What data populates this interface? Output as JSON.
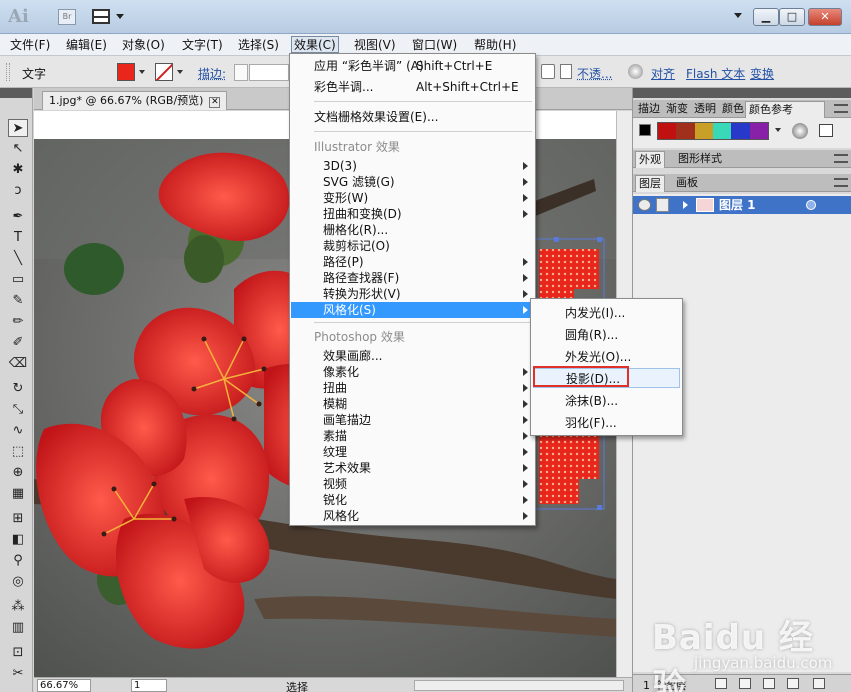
{
  "app": {
    "logo": "Ai",
    "bridge_badge": "Br"
  },
  "window_buttons": {
    "minimize": "▁",
    "maximize": "□",
    "close": "✕"
  },
  "menubar": {
    "items": [
      "文件(F)",
      "编辑(E)",
      "对象(O)",
      "文字(T)",
      "选择(S)",
      "效果(C)",
      "视图(V)",
      "窗口(W)",
      "帮助(H)"
    ]
  },
  "controlbar": {
    "type_label": "文字",
    "fill_color": "#e8261c",
    "stroke_label": "描边:",
    "opacity_label": "不透...",
    "align_label": "对齐",
    "flash_text_label": "Flash 文本",
    "transform_label": "变换"
  },
  "document": {
    "tab_title": "1.jpg* @ 66.67% (RGB/预览)",
    "close": "✕"
  },
  "statusbar": {
    "zoom": "66.67%",
    "page": "1",
    "status": "选择"
  },
  "effect_menu": {
    "apply_last": {
      "label": "应用 “彩色半调” (A)",
      "shortcut": "Shift+Ctrl+E"
    },
    "last_effect": {
      "label": "彩色半调...",
      "shortcut": "Alt+Shift+Ctrl+E"
    },
    "raster_settings": "文档栅格效果设置(E)...",
    "illustrator_header": "Illustrator 效果",
    "illustrator_items": [
      "3D(3)",
      "SVG 滤镜(G)",
      "变形(W)",
      "扭曲和变换(D)",
      "栅格化(R)...",
      "裁剪标记(O)",
      "路径(P)",
      "路径查找器(F)",
      "转换为形状(V)",
      "风格化(S)"
    ],
    "photoshop_header": "Photoshop 效果",
    "photoshop_items": [
      "效果画廊...",
      "像素化",
      "扭曲",
      "模糊",
      "画笔描边",
      "素描",
      "纹理",
      "艺术效果",
      "视频",
      "锐化",
      "风格化"
    ]
  },
  "stylize_submenu": {
    "items": [
      "内发光(I)...",
      "圆角(R)...",
      "外发光(O)...",
      "投影(D)...",
      "涂抹(B)...",
      "羽化(F)..."
    ],
    "highlight_color": "#e0302a"
  },
  "panels": {
    "top_tabs": [
      "描边",
      "渐变",
      "透明",
      "颜色",
      "颜色参考"
    ],
    "color_guide_swatches": [
      "#c01010",
      "#a0301c",
      "#c8a028",
      "#38d8b8",
      "#2838c8",
      "#8820a8"
    ],
    "mid_tabs": [
      "外观",
      "图形样式"
    ],
    "layer_tabs": [
      "图层",
      "画板"
    ],
    "layer_name": "图层 1",
    "layer_count": "1 个图层"
  },
  "watermark": {
    "logo": "Baidu 经验",
    "url": "jingyan.baidu.com"
  }
}
